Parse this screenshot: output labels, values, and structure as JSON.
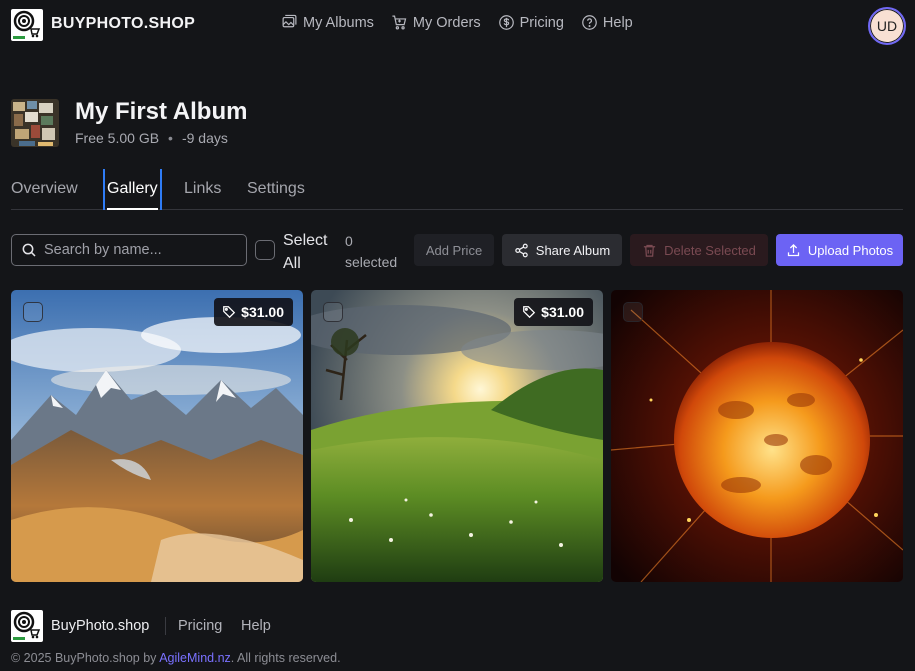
{
  "header": {
    "brand": "BUYPHOTO.SHOP",
    "nav": [
      {
        "label": "My Albums",
        "icon": "albums-icon"
      },
      {
        "label": "My Orders",
        "icon": "cart-icon"
      },
      {
        "label": "Pricing",
        "icon": "dollar-icon"
      },
      {
        "label": "Help",
        "icon": "help-icon"
      }
    ],
    "avatar_initials": "UD"
  },
  "album": {
    "title": "My First Album",
    "plan": "Free 5.00 GB",
    "separator": "•",
    "expires": "-9 days"
  },
  "tabs": [
    {
      "label": "Overview",
      "active": false
    },
    {
      "label": "Gallery",
      "active": true
    },
    {
      "label": "Links",
      "active": false
    },
    {
      "label": "Settings",
      "active": false
    }
  ],
  "toolbar": {
    "search_placeholder": "Search by name...",
    "select_all_label": "Select All",
    "selected_count": "0 selected",
    "add_price_label": "Add Price",
    "share_label": "Share Album",
    "delete_label": "Delete Selected",
    "upload_label": "Upload Photos"
  },
  "photos": [
    {
      "subject": "mountains",
      "price": "$31.00",
      "selected": false
    },
    {
      "subject": "grassy hills at sunset",
      "price": "$31.00",
      "selected": false
    },
    {
      "subject": "burning sun",
      "price": null,
      "selected": false
    }
  ],
  "footer": {
    "brand": "BuyPhoto.shop",
    "links": [
      "Pricing",
      "Help"
    ],
    "copyright_prefix": "© 2025 BuyPhoto.shop by ",
    "copyright_link": "AgileMind.nz",
    "copyright_suffix": ". All rights reserved."
  },
  "colors": {
    "background": "#141518",
    "accent": "#6c63f4",
    "active_tab_border": "#2f7cf6",
    "danger_bg": "#2a1a1e"
  }
}
